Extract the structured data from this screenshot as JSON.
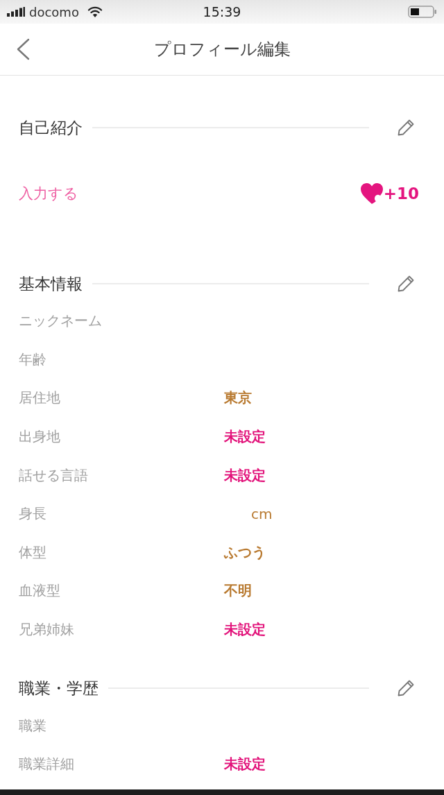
{
  "status_bar": {
    "carrier": "docomo",
    "time": "15:39"
  },
  "nav_bar": {
    "title": "プロフィール編集"
  },
  "sections": [
    {
      "kind": "intro",
      "title": "自己紹介",
      "prompt": "入力する",
      "reward": "+10"
    },
    {
      "kind": "fields",
      "title": "基本情報",
      "rows": [
        {
          "kind": "empty",
          "label": "ニックネーム"
        },
        {
          "kind": "empty",
          "label": "年齢"
        },
        {
          "kind": "text",
          "label": "居住地",
          "value": "東京",
          "unset": false
        },
        {
          "kind": "text",
          "label": "出身地",
          "value": "未設定",
          "unset": true
        },
        {
          "kind": "text",
          "label": "話せる言語",
          "value": "未設定",
          "unset": true
        },
        {
          "kind": "measure",
          "label": "身長",
          "unit": "cm",
          "unset": false
        },
        {
          "kind": "text",
          "label": "体型",
          "value": "ふつう",
          "unset": false
        },
        {
          "kind": "text",
          "label": "血液型",
          "value": "不明",
          "unset": false
        },
        {
          "kind": "text",
          "label": "兄弟姉妹",
          "value": "未設定",
          "unset": true
        }
      ]
    },
    {
      "kind": "fields",
      "title": "職業・学歴",
      "rows": [
        {
          "kind": "empty",
          "label": "職業"
        },
        {
          "kind": "text",
          "label": "職業詳細",
          "value": "未設定",
          "unset": true
        }
      ]
    }
  ]
}
